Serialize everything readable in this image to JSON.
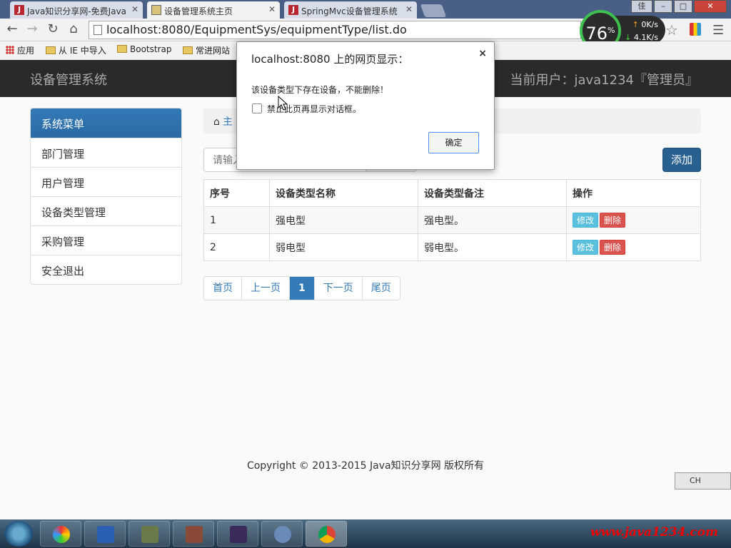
{
  "browser": {
    "tabs": [
      {
        "title": "Java知识分享网-免费Java"
      },
      {
        "title": "设备管理系统主页"
      },
      {
        "title": "SpringMvc设备管理系统"
      }
    ],
    "url": "localhost:8080/EquipmentSys/equipmentType/list.do",
    "bookmarks": [
      "应用",
      "从 IE 中导入",
      "Bootstrap",
      "常进网站"
    ],
    "window_buttons": [
      "佳",
      "–",
      "□",
      "✕"
    ]
  },
  "speed_widget": {
    "percent": "76",
    "unit": "%",
    "up": "0",
    "down": "4.1",
    "rate_unit": "K/s"
  },
  "header": {
    "brand": "设备管理系统",
    "current_user": "当前用户：java1234『管理员』"
  },
  "sidebar": {
    "title": "系统菜单",
    "items": [
      {
        "label": "部门管理"
      },
      {
        "label": "用户管理"
      },
      {
        "label": "设备类型管理"
      },
      {
        "label": "采购管理"
      },
      {
        "label": "安全退出"
      }
    ]
  },
  "breadcrumb": {
    "home": "主"
  },
  "search": {
    "placeholder": "请输入"
  },
  "toolbar": {
    "add_label": "添加"
  },
  "table": {
    "headers": [
      "序号",
      "设备类型名称",
      "设备类型备注",
      "操作"
    ],
    "rows": [
      {
        "id": "1",
        "name": "强电型",
        "remark": "强电型。"
      },
      {
        "id": "2",
        "name": "弱电型",
        "remark": "弱电型。"
      }
    ],
    "edit_label": "修改",
    "delete_label": "删除"
  },
  "pagination": {
    "first": "首页",
    "prev": "上一页",
    "current": "1",
    "next": "下一页",
    "last": "尾页"
  },
  "footer": {
    "copyright": "Copyright © 2013-2015 Java知识分享网 版权所有"
  },
  "dialog": {
    "title": "localhost:8080 上的网页显示：",
    "message": "该设备类型下存在设备，不能删除！",
    "checkbox_label": "禁止此页再显示对话框。",
    "ok_label": "确定",
    "close": "×"
  },
  "ime": {
    "label": "CH"
  },
  "watermark": "www.java1234.com",
  "colors": {
    "primary": "#337ab7",
    "danger": "#d9534f",
    "info": "#5bc0de",
    "header_bg": "#2a2a2a"
  }
}
